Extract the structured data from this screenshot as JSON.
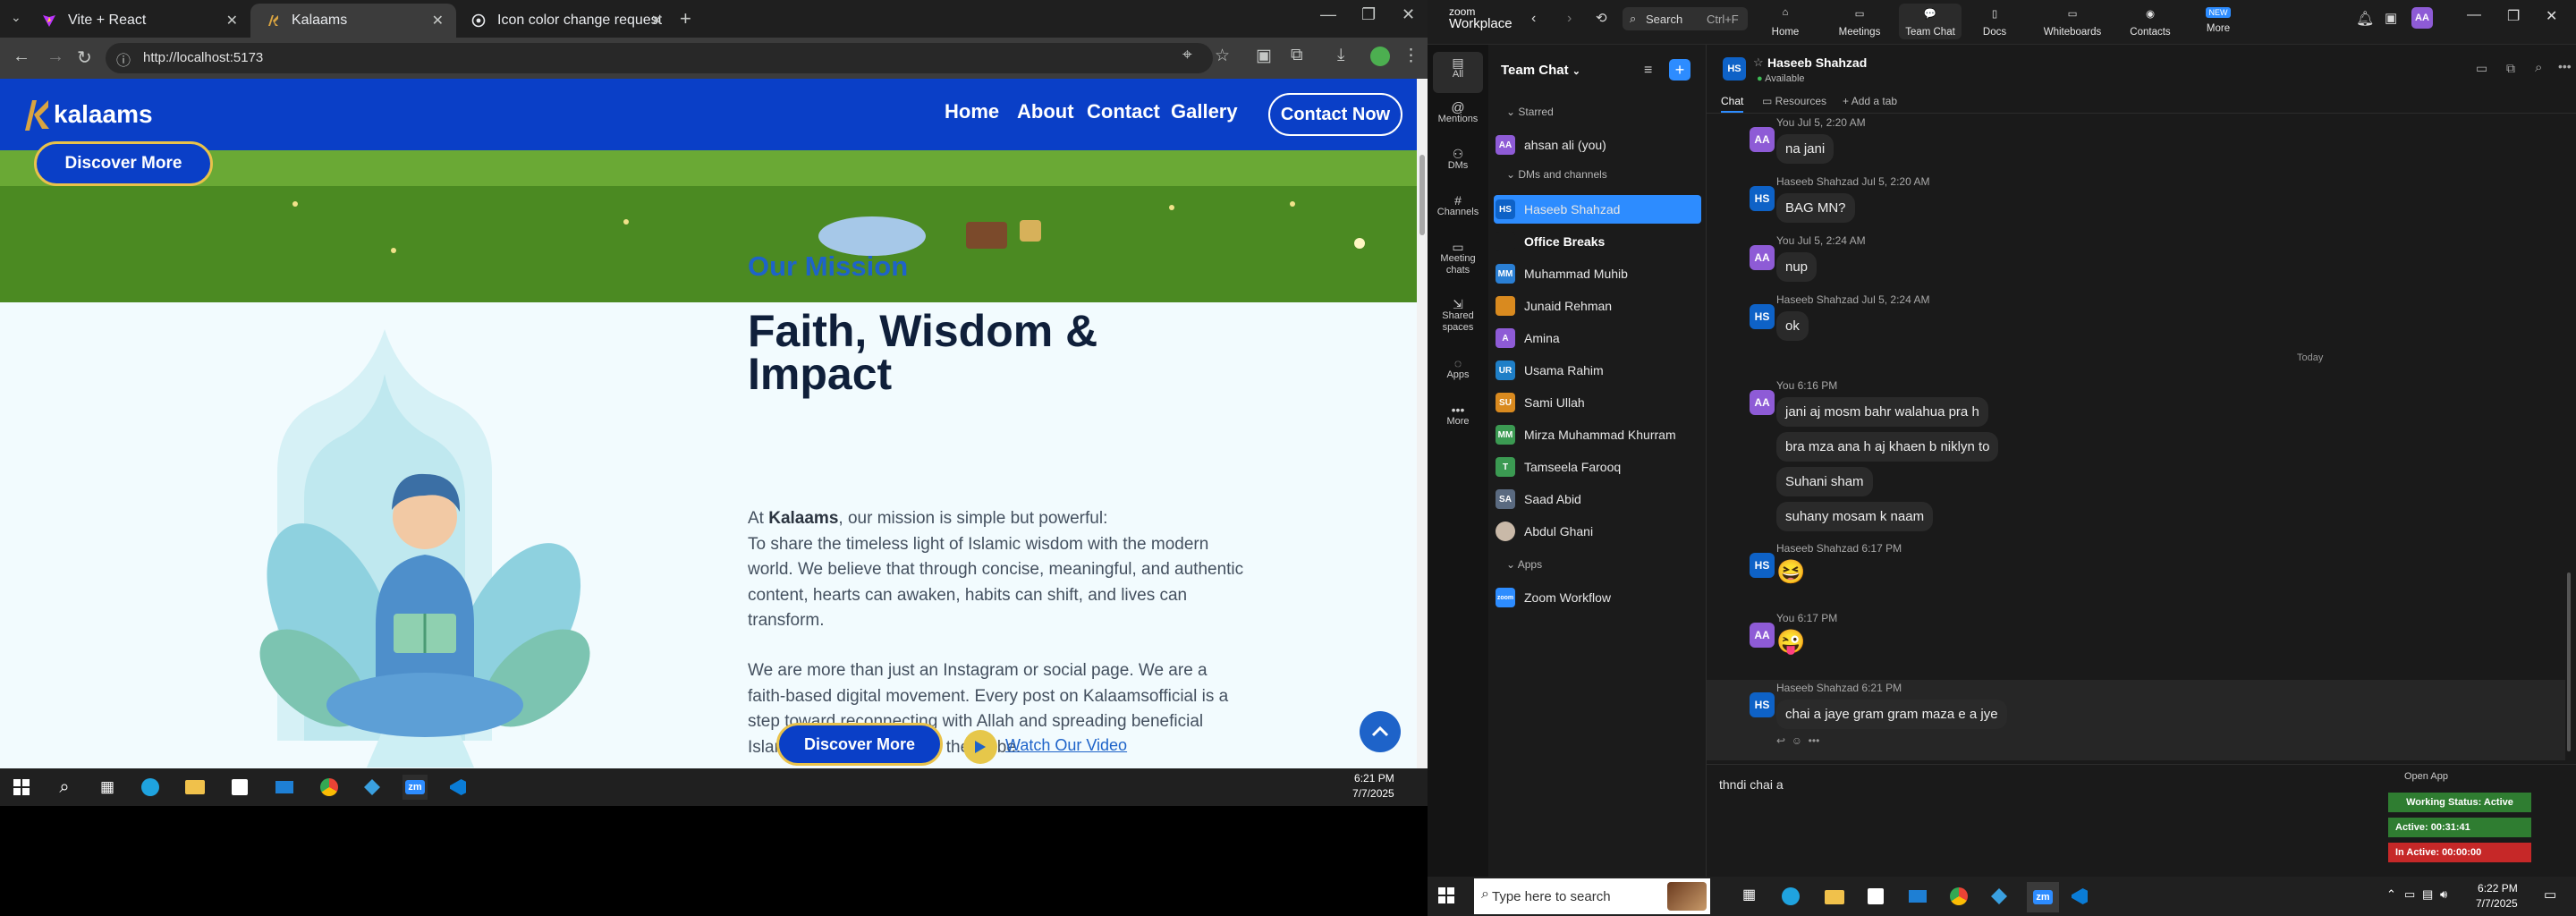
{
  "browser": {
    "tabs": [
      {
        "title": "Vite + React"
      },
      {
        "title": "Kalaams"
      },
      {
        "title": "Icon color change request"
      }
    ],
    "url": "http://localhost:5173"
  },
  "site": {
    "logo": "kalaams",
    "nav": [
      "Home",
      "About",
      "Contact",
      "Gallery"
    ],
    "contact_button": "Contact Now",
    "hero_button": "Discover More",
    "mission_label": "Our Mission",
    "heading": "Faith, Wisdom & Impact",
    "para1_prefix": "At ",
    "para1_brand": "Kalaams",
    "para1_rest": ", our mission is simple but powerful:",
    "para1_body": "To share the timeless light of Islamic wisdom with the modern world. We believe that through concise, meaningful, and authentic content, hearts can awaken, habits can shift, and lives can transform.",
    "para2": "We are more than just an Instagram or social page. We are a faith-based digital movement. Every post on Kalaamsofficial is a step toward reconnecting with Allah and spreading beneficial Islamic knowledge across the globe.",
    "bottom_button": "Discover More",
    "watch_video": "Watch Our Video"
  },
  "left_taskbar": {
    "time": "6:21 PM",
    "date": "7/7/2025"
  },
  "zoom": {
    "brand_top": "zoom",
    "brand_bottom": "Workplace",
    "search_label": "Search",
    "search_shortcut": "Ctrl+F",
    "top_tabs": [
      "Home",
      "Meetings",
      "Team Chat",
      "Docs",
      "Whiteboards",
      "Contacts",
      "More"
    ],
    "new_badge": "NEW",
    "rail": [
      "All",
      "Mentions",
      "DMs",
      "Channels",
      "Meeting chats",
      "Shared spaces",
      "Apps",
      "More"
    ],
    "pane_title": "Team Chat",
    "starred_label": "Starred",
    "starred": [
      {
        "initials": "AA",
        "name": "ahsan ali (you)"
      }
    ],
    "dms_label": "DMs and channels",
    "dms": [
      {
        "initials": "HS",
        "name": "Haseeb Shahzad",
        "selected": true
      },
      {
        "initials": "",
        "name": "Office Breaks",
        "bold": true
      },
      {
        "initials": "MM",
        "name": "Muhammad Muhib"
      },
      {
        "initials": "JR",
        "name": "Junaid Rehman"
      },
      {
        "initials": "A",
        "name": "Amina"
      },
      {
        "initials": "UR",
        "name": "Usama Rahim"
      },
      {
        "initials": "SU",
        "name": "Sami Ullah"
      },
      {
        "initials": "MM",
        "name": "Mirza Muhammad Khurram"
      },
      {
        "initials": "T",
        "name": "Tamseela Farooq"
      },
      {
        "initials": "SA",
        "name": "Saad Abid"
      },
      {
        "initials": "",
        "name": "Abdul Ghani"
      }
    ],
    "apps_label": "Apps",
    "apps": [
      {
        "name": "Zoom Workflow"
      }
    ],
    "chat_header_initials": "HS",
    "chat_header_name": "Haseeb Shahzad",
    "chat_header_status": "Available",
    "chat_tabs": [
      "Chat",
      "Resources",
      "Add a tab"
    ],
    "messages": [
      {
        "initials": "AA",
        "meta": "You Jul 5, 2:20 AM",
        "text": "na jani"
      },
      {
        "initials": "HS",
        "meta": "Haseeb Shahzad Jul 5, 2:20 AM",
        "text": "BAG MN?"
      },
      {
        "initials": "AA",
        "meta": "You Jul 5, 2:24 AM",
        "text": "nup"
      },
      {
        "initials": "HS",
        "meta": "Haseeb Shahzad Jul 5, 2:24 AM",
        "text": "ok"
      }
    ],
    "day_divider": "Today",
    "today_block": {
      "meta": "You 6:16 PM",
      "lines": [
        "jani aj mosm bahr walahua pra h",
        "bra mza ana h aj khaen b niklyn to",
        "Suhani sham",
        "suhany mosam k naam"
      ]
    },
    "later": [
      {
        "initials": "HS",
        "meta": "Haseeb Shahzad 6:17 PM",
        "emoji": "😆"
      },
      {
        "initials": "AA",
        "meta": "You 6:17 PM",
        "emoji": "😜"
      },
      {
        "initials": "HS",
        "meta": "Haseeb Shahzad 6:21 PM",
        "text": "chai a jaye gram gram maza e a jye"
      }
    ],
    "compose_text": "thndi chai a",
    "open_app": "Open App",
    "status_widget": [
      "Working Status: Active",
      "Active: 00:31:41",
      "In Active: 00:00:00"
    ]
  },
  "right_taskbar": {
    "search_placeholder": "Type here to search",
    "time": "6:22 PM",
    "date": "7/7/2025"
  }
}
